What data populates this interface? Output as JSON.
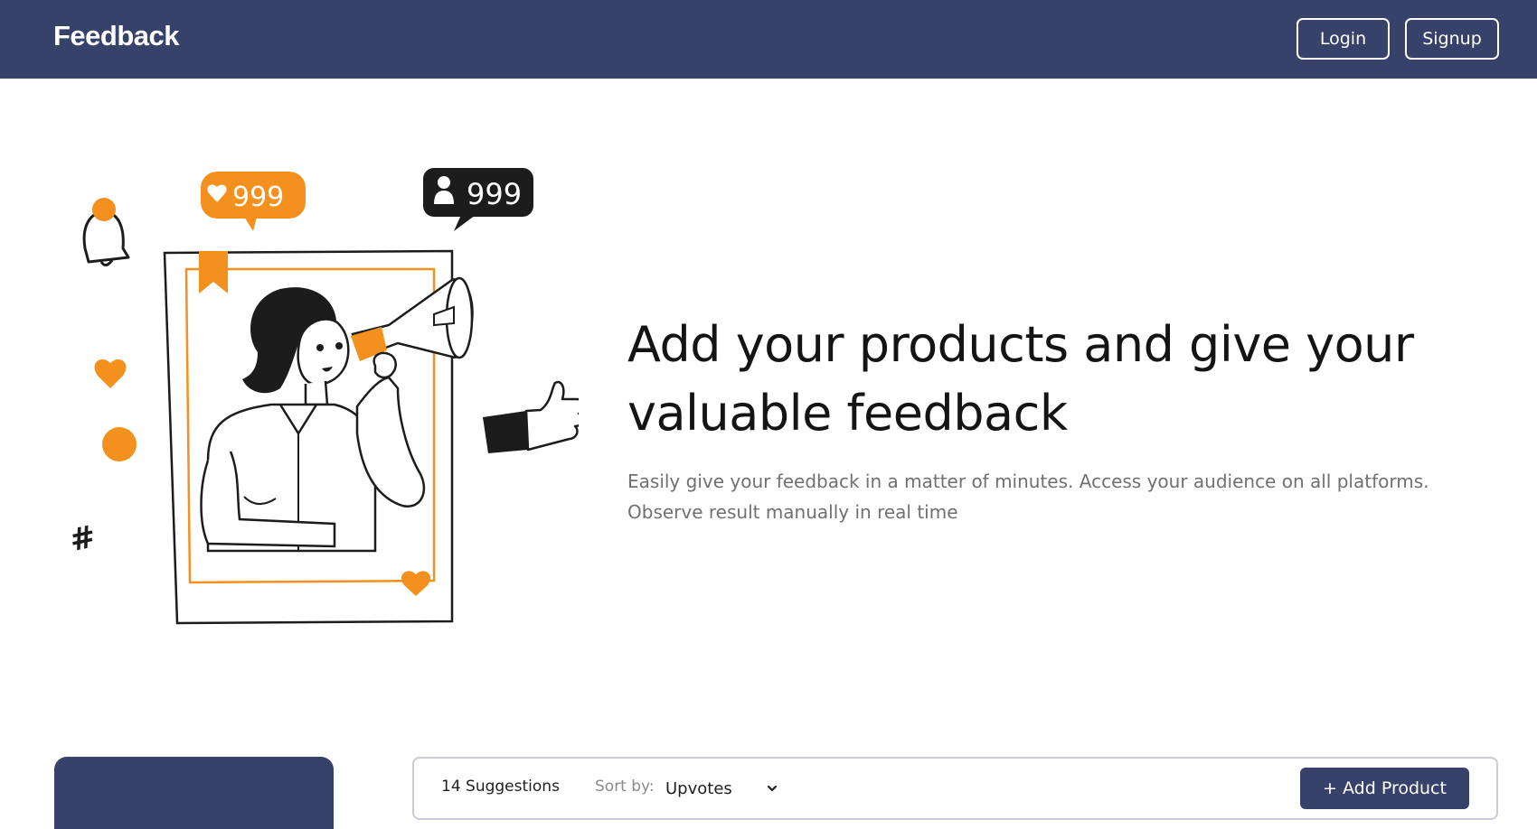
{
  "header": {
    "brand": "Feedback",
    "login_label": "Login",
    "signup_label": "Signup"
  },
  "hero": {
    "title": "Add your products and give your valuable feedback",
    "subtitle": "Easily give your feedback in a matter of minutes. Access your audience on all platforms. Observe result manually in real time",
    "illustration": {
      "likes_badge": "999",
      "followers_badge": "999",
      "hashtag": "#"
    }
  },
  "toolbar": {
    "suggestions": "14 Suggestions",
    "sort_label": "Sort by:",
    "sort_value": "Upvotes",
    "add_product_label": "+ Add Product"
  },
  "colors": {
    "primary": "#37426a",
    "accent": "#f4901e",
    "text": "#141414",
    "muted": "#707070"
  },
  "icons": [
    "heart-icon",
    "user-icon",
    "bell-icon",
    "megaphone-icon",
    "thumbs-up-icon",
    "chevron-down-icon"
  ]
}
